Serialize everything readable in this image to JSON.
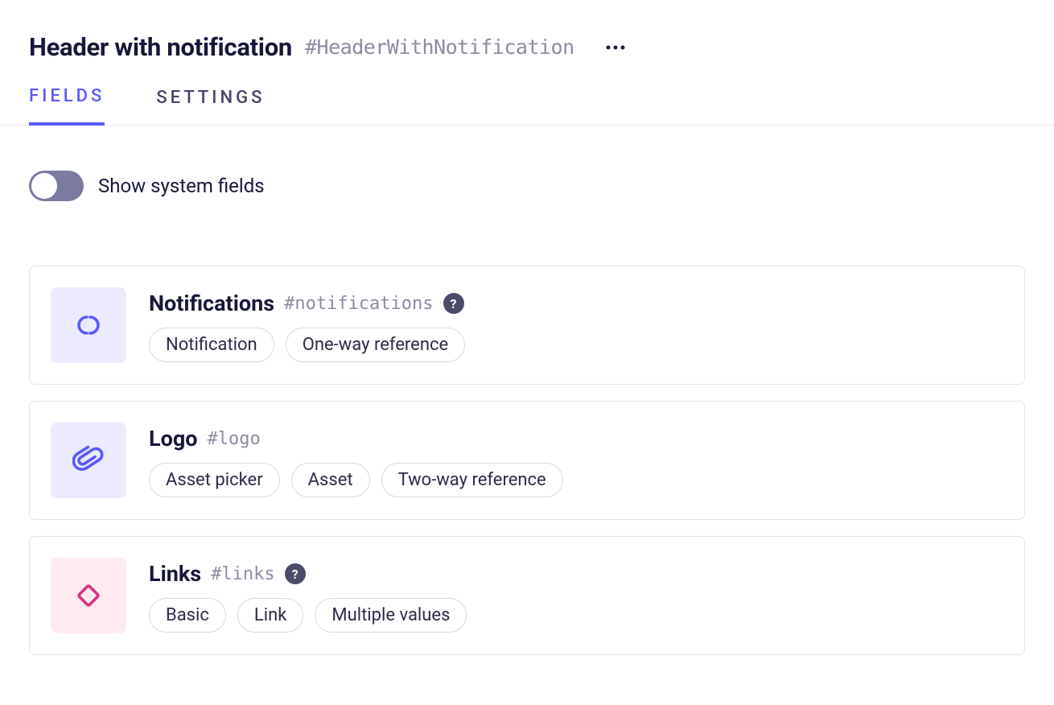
{
  "header": {
    "title": "Header with notification",
    "slug": "#HeaderWithNotification"
  },
  "tabs": {
    "fields": "FIELDS",
    "settings": "SETTINGS"
  },
  "toggle": {
    "label": "Show system fields"
  },
  "help_marker": "?",
  "fields": [
    {
      "icon": "link-icon",
      "icon_theme": "purple",
      "name": "Notifications",
      "slug": "#notifications",
      "has_help": true,
      "tags": [
        "Notification",
        "One-way reference"
      ]
    },
    {
      "icon": "paperclip-icon",
      "icon_theme": "purple",
      "name": "Logo",
      "slug": "#logo",
      "has_help": false,
      "tags": [
        "Asset picker",
        "Asset",
        "Two-way reference"
      ]
    },
    {
      "icon": "diamond-icon",
      "icon_theme": "pink",
      "name": "Links",
      "slug": "#links",
      "has_help": true,
      "tags": [
        "Basic",
        "Link",
        "Multiple values"
      ]
    }
  ]
}
